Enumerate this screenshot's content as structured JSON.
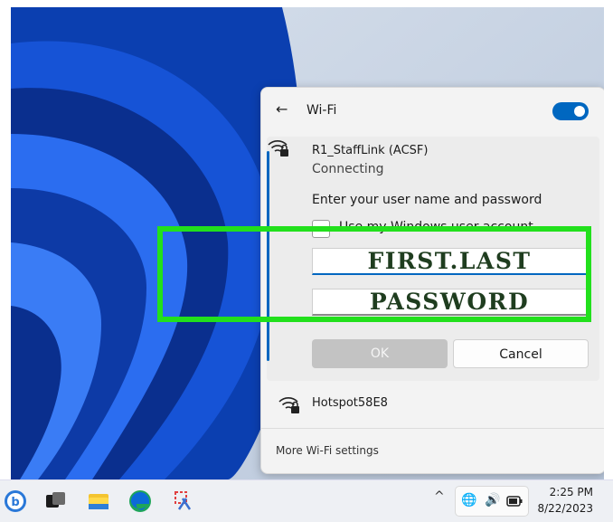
{
  "wifi_panel": {
    "back_icon": "arrow-left-icon",
    "title": "Wi-Fi",
    "toggle_on": true,
    "accent_color": "#0067c0",
    "active_network": {
      "name": "R1_StaffLink (ACSF)",
      "status": "Connecting",
      "prompt": "Enter your user name and password",
      "use_windows_account_label": "Use my Windows user account",
      "username_value": "FIRST.LAST",
      "password_value": "PASSWORD",
      "ok_label": "OK",
      "cancel_label": "Cancel"
    },
    "other_network": {
      "name": "Hotspot58E8"
    },
    "more_settings_label": "More Wi-Fi settings"
  },
  "highlight_color": "#22e01c",
  "taskbar": {
    "icons": [
      "bing-icon",
      "task-view-icon",
      "file-explorer-icon",
      "edge-icon",
      "snipping-tool-icon"
    ],
    "tray": {
      "chevron": "^",
      "icons": [
        "network-icon",
        "volume-icon",
        "battery-icon"
      ]
    },
    "time": "2:25 PM",
    "date": "8/22/2023"
  }
}
